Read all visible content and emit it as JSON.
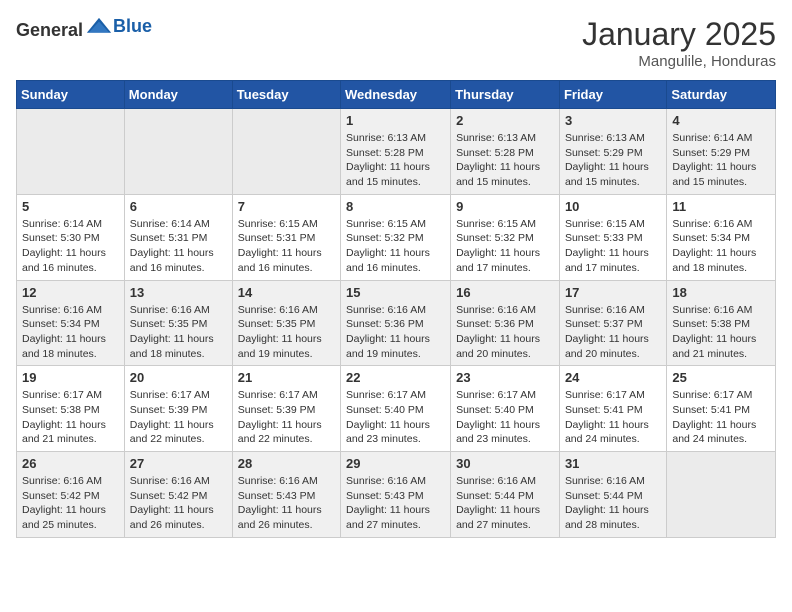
{
  "header": {
    "logo_general": "General",
    "logo_blue": "Blue",
    "month_year": "January 2025",
    "location": "Mangulile, Honduras"
  },
  "weekdays": [
    "Sunday",
    "Monday",
    "Tuesday",
    "Wednesday",
    "Thursday",
    "Friday",
    "Saturday"
  ],
  "weeks": [
    [
      {
        "day": "",
        "info": ""
      },
      {
        "day": "",
        "info": ""
      },
      {
        "day": "",
        "info": ""
      },
      {
        "day": "1",
        "info": "Sunrise: 6:13 AM\nSunset: 5:28 PM\nDaylight: 11 hours\nand 15 minutes."
      },
      {
        "day": "2",
        "info": "Sunrise: 6:13 AM\nSunset: 5:28 PM\nDaylight: 11 hours\nand 15 minutes."
      },
      {
        "day": "3",
        "info": "Sunrise: 6:13 AM\nSunset: 5:29 PM\nDaylight: 11 hours\nand 15 minutes."
      },
      {
        "day": "4",
        "info": "Sunrise: 6:14 AM\nSunset: 5:29 PM\nDaylight: 11 hours\nand 15 minutes."
      }
    ],
    [
      {
        "day": "5",
        "info": "Sunrise: 6:14 AM\nSunset: 5:30 PM\nDaylight: 11 hours\nand 16 minutes."
      },
      {
        "day": "6",
        "info": "Sunrise: 6:14 AM\nSunset: 5:31 PM\nDaylight: 11 hours\nand 16 minutes."
      },
      {
        "day": "7",
        "info": "Sunrise: 6:15 AM\nSunset: 5:31 PM\nDaylight: 11 hours\nand 16 minutes."
      },
      {
        "day": "8",
        "info": "Sunrise: 6:15 AM\nSunset: 5:32 PM\nDaylight: 11 hours\nand 16 minutes."
      },
      {
        "day": "9",
        "info": "Sunrise: 6:15 AM\nSunset: 5:32 PM\nDaylight: 11 hours\nand 17 minutes."
      },
      {
        "day": "10",
        "info": "Sunrise: 6:15 AM\nSunset: 5:33 PM\nDaylight: 11 hours\nand 17 minutes."
      },
      {
        "day": "11",
        "info": "Sunrise: 6:16 AM\nSunset: 5:34 PM\nDaylight: 11 hours\nand 18 minutes."
      }
    ],
    [
      {
        "day": "12",
        "info": "Sunrise: 6:16 AM\nSunset: 5:34 PM\nDaylight: 11 hours\nand 18 minutes."
      },
      {
        "day": "13",
        "info": "Sunrise: 6:16 AM\nSunset: 5:35 PM\nDaylight: 11 hours\nand 18 minutes."
      },
      {
        "day": "14",
        "info": "Sunrise: 6:16 AM\nSunset: 5:35 PM\nDaylight: 11 hours\nand 19 minutes."
      },
      {
        "day": "15",
        "info": "Sunrise: 6:16 AM\nSunset: 5:36 PM\nDaylight: 11 hours\nand 19 minutes."
      },
      {
        "day": "16",
        "info": "Sunrise: 6:16 AM\nSunset: 5:36 PM\nDaylight: 11 hours\nand 20 minutes."
      },
      {
        "day": "17",
        "info": "Sunrise: 6:16 AM\nSunset: 5:37 PM\nDaylight: 11 hours\nand 20 minutes."
      },
      {
        "day": "18",
        "info": "Sunrise: 6:16 AM\nSunset: 5:38 PM\nDaylight: 11 hours\nand 21 minutes."
      }
    ],
    [
      {
        "day": "19",
        "info": "Sunrise: 6:17 AM\nSunset: 5:38 PM\nDaylight: 11 hours\nand 21 minutes."
      },
      {
        "day": "20",
        "info": "Sunrise: 6:17 AM\nSunset: 5:39 PM\nDaylight: 11 hours\nand 22 minutes."
      },
      {
        "day": "21",
        "info": "Sunrise: 6:17 AM\nSunset: 5:39 PM\nDaylight: 11 hours\nand 22 minutes."
      },
      {
        "day": "22",
        "info": "Sunrise: 6:17 AM\nSunset: 5:40 PM\nDaylight: 11 hours\nand 23 minutes."
      },
      {
        "day": "23",
        "info": "Sunrise: 6:17 AM\nSunset: 5:40 PM\nDaylight: 11 hours\nand 23 minutes."
      },
      {
        "day": "24",
        "info": "Sunrise: 6:17 AM\nSunset: 5:41 PM\nDaylight: 11 hours\nand 24 minutes."
      },
      {
        "day": "25",
        "info": "Sunrise: 6:17 AM\nSunset: 5:41 PM\nDaylight: 11 hours\nand 24 minutes."
      }
    ],
    [
      {
        "day": "26",
        "info": "Sunrise: 6:16 AM\nSunset: 5:42 PM\nDaylight: 11 hours\nand 25 minutes."
      },
      {
        "day": "27",
        "info": "Sunrise: 6:16 AM\nSunset: 5:42 PM\nDaylight: 11 hours\nand 26 minutes."
      },
      {
        "day": "28",
        "info": "Sunrise: 6:16 AM\nSunset: 5:43 PM\nDaylight: 11 hours\nand 26 minutes."
      },
      {
        "day": "29",
        "info": "Sunrise: 6:16 AM\nSunset: 5:43 PM\nDaylight: 11 hours\nand 27 minutes."
      },
      {
        "day": "30",
        "info": "Sunrise: 6:16 AM\nSunset: 5:44 PM\nDaylight: 11 hours\nand 27 minutes."
      },
      {
        "day": "31",
        "info": "Sunrise: 6:16 AM\nSunset: 5:44 PM\nDaylight: 11 hours\nand 28 minutes."
      },
      {
        "day": "",
        "info": ""
      }
    ]
  ]
}
